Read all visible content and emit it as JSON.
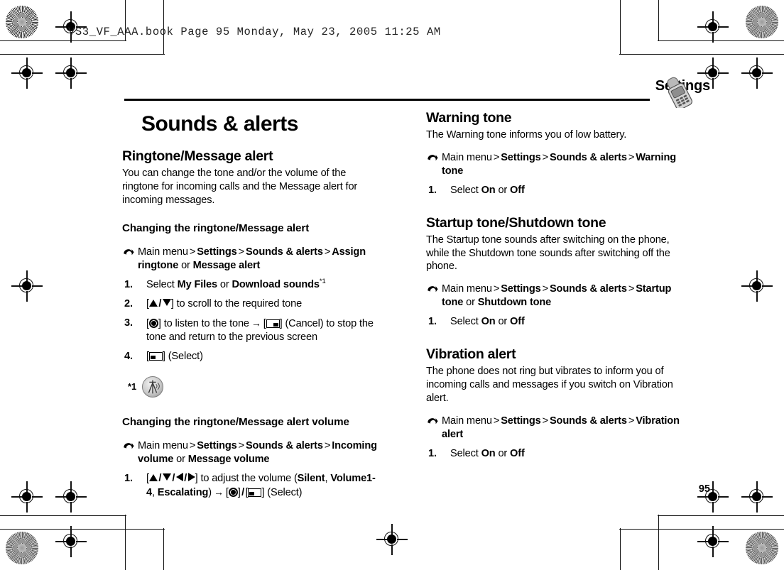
{
  "print_header": {
    "text": "VS3_VF_AAA.book   Page 95   Monday,  May 23,  2005   11:25 AM"
  },
  "running_header": {
    "section": "Settings",
    "icon": "mobile-phone-icon"
  },
  "page": {
    "title": "Sounds & alerts",
    "number": "95"
  },
  "left_column": {
    "section1": {
      "heading": "Ringtone/Message alert",
      "intro": "You can change the tone and/or the volume of the ringtone for incoming calls and the Message alert for incoming messages.",
      "sub1": {
        "heading": "Changing the ringtone/Message alert",
        "path_prefix": "Main menu",
        "path_p1": "Settings",
        "path_p2": "Sounds & alerts",
        "path_p3": "Assign ringtone",
        "path_or": "or",
        "path_p4": "Message alert",
        "steps": [
          {
            "num": "1.",
            "lead": "Select",
            "opt1": "My Files",
            "or": "or",
            "opt2": "Download sounds",
            "footnote_ref": "*1"
          },
          {
            "num": "2.",
            "text": "to scroll to the required tone"
          },
          {
            "num": "3.",
            "text_a": "to listen to the tone",
            "text_b": "(Cancel) to stop the tone and return to the previous screen"
          },
          {
            "num": "4.",
            "text": "(Select)"
          }
        ],
        "footnote": {
          "marker": "*1",
          "icon": "network-service-icon"
        }
      },
      "sub2": {
        "heading": "Changing the ringtone/Message alert volume",
        "path_prefix": "Main menu",
        "path_p1": "Settings",
        "path_p2": "Sounds & alerts",
        "path_p3": "Incoming volume",
        "path_or": "or",
        "path_p4": "Message volume",
        "step": {
          "num": "1.",
          "text_a": "to adjust the volume (",
          "val1": "Silent",
          "sep1": ", ",
          "val2": "Volume1-4",
          "sep2": ", ",
          "val3": "Escalating",
          "text_b": ")",
          "text_c": "(Select)"
        }
      }
    }
  },
  "right_column": {
    "section_warning": {
      "heading": "Warning tone",
      "intro": "The Warning tone informs you of low battery.",
      "path_prefix": "Main menu",
      "path_p1": "Settings",
      "path_p2": "Sounds & alerts",
      "path_p3": "Warning tone",
      "step": {
        "num": "1.",
        "lead": "Select",
        "on": "On",
        "or": "or",
        "off": "Off"
      }
    },
    "section_startup": {
      "heading": "Startup tone/Shutdown tone",
      "intro": "The Startup tone sounds after switching on the phone, while the Shutdown tone sounds after switching off the phone.",
      "path_prefix": "Main menu",
      "path_p1": "Settings",
      "path_p2": "Sounds & alerts",
      "path_p3": "Startup tone",
      "path_or": "or",
      "path_p4": "Shutdown tone",
      "step": {
        "num": "1.",
        "lead": "Select",
        "on": "On",
        "or": "or",
        "off": "Off"
      }
    },
    "section_vibration": {
      "heading": "Vibration alert",
      "intro": "The phone does not ring but vibrates to inform you of incoming calls and messages if you switch on Vibration alert.",
      "path_prefix": "Main menu",
      "path_p1": "Settings",
      "path_p2": "Sounds & alerts",
      "path_p3": "Vibration alert",
      "step": {
        "num": "1.",
        "lead": "Select",
        "on": "On",
        "or": "or",
        "off": "Off"
      }
    }
  },
  "symbols": {
    "gt": ">",
    "arrow_to": "→",
    "slash": "/"
  },
  "colors": {
    "text": "#000000",
    "paper": "#ffffff"
  }
}
